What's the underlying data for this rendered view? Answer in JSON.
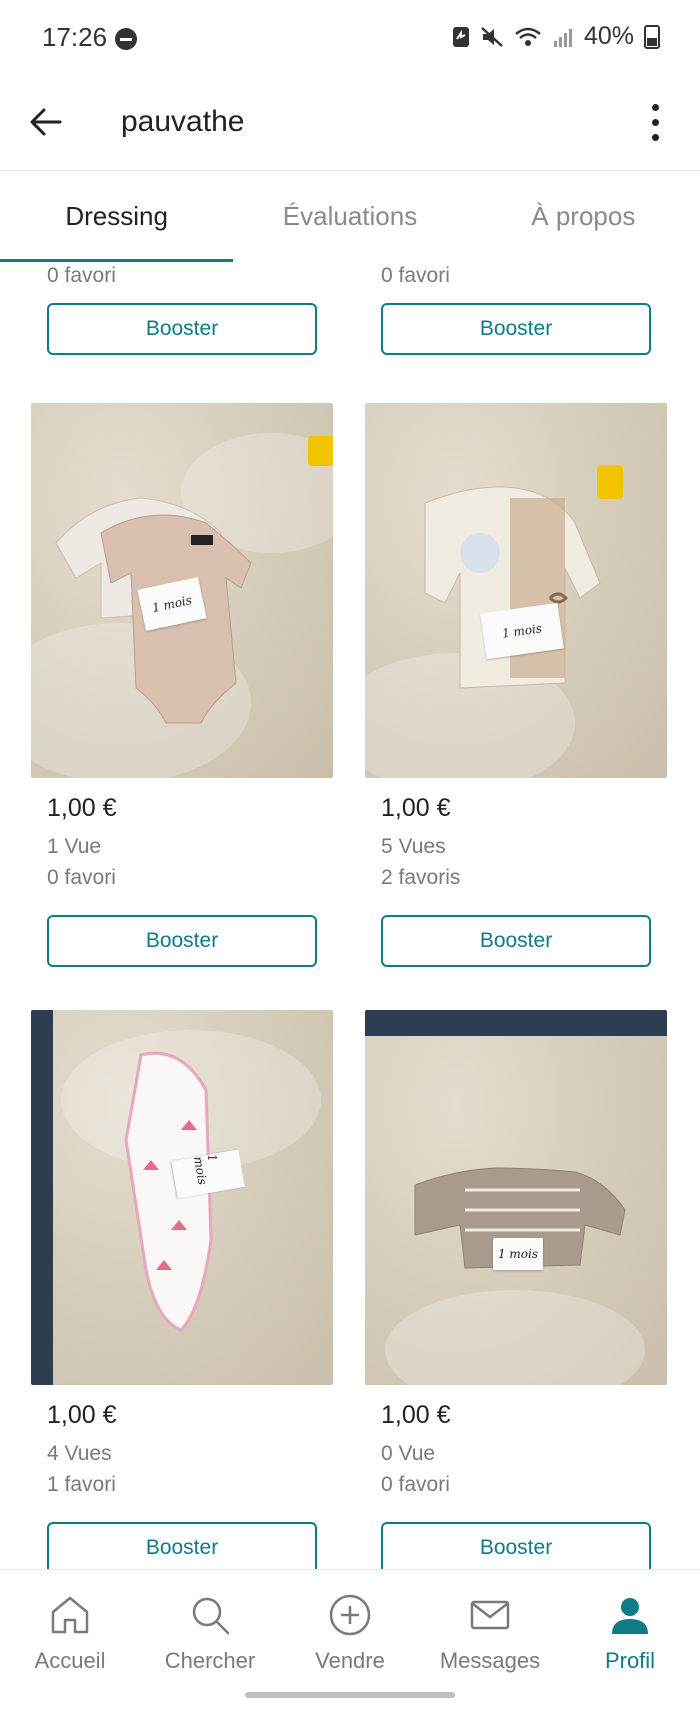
{
  "status_bar": {
    "time": "17:26",
    "battery": "40%"
  },
  "app_bar": {
    "title": "pauvathe"
  },
  "tabs": [
    {
      "label": "Dressing",
      "active": true
    },
    {
      "label": "Évaluations",
      "active": false
    },
    {
      "label": "À propos",
      "active": false
    }
  ],
  "partial_items": [
    {
      "favorites": "0 favori",
      "boost_label": "Booster"
    },
    {
      "favorites": "0 favori",
      "boost_label": "Booster"
    }
  ],
  "items": [
    {
      "price": "1,00 €",
      "views": "1 Vue",
      "favorites": "0 favori",
      "boost_label": "Booster",
      "tag_text": "1 mois"
    },
    {
      "price": "1,00 €",
      "views": "5 Vues",
      "favorites": "2 favoris",
      "boost_label": "Booster",
      "tag_text": "1 mois"
    },
    {
      "price": "1,00 €",
      "views": "4 Vues",
      "favorites": "1 favori",
      "boost_label": "Booster",
      "tag_text": "1 mois"
    },
    {
      "price": "1,00 €",
      "views": "0 Vue",
      "favorites": "0 favori",
      "boost_label": "Booster",
      "tag_text": "1 mois"
    }
  ],
  "bottom_nav": [
    {
      "label": "Accueil",
      "icon": "home-icon",
      "active": false
    },
    {
      "label": "Chercher",
      "icon": "search-icon",
      "active": false
    },
    {
      "label": "Vendre",
      "icon": "plus-circle-icon",
      "active": false
    },
    {
      "label": "Messages",
      "icon": "mail-icon",
      "active": false
    },
    {
      "label": "Profil",
      "icon": "profile-icon",
      "active": true
    }
  ],
  "colors": {
    "accent": "#0e7c86",
    "muted_text": "#7a7a7a"
  }
}
